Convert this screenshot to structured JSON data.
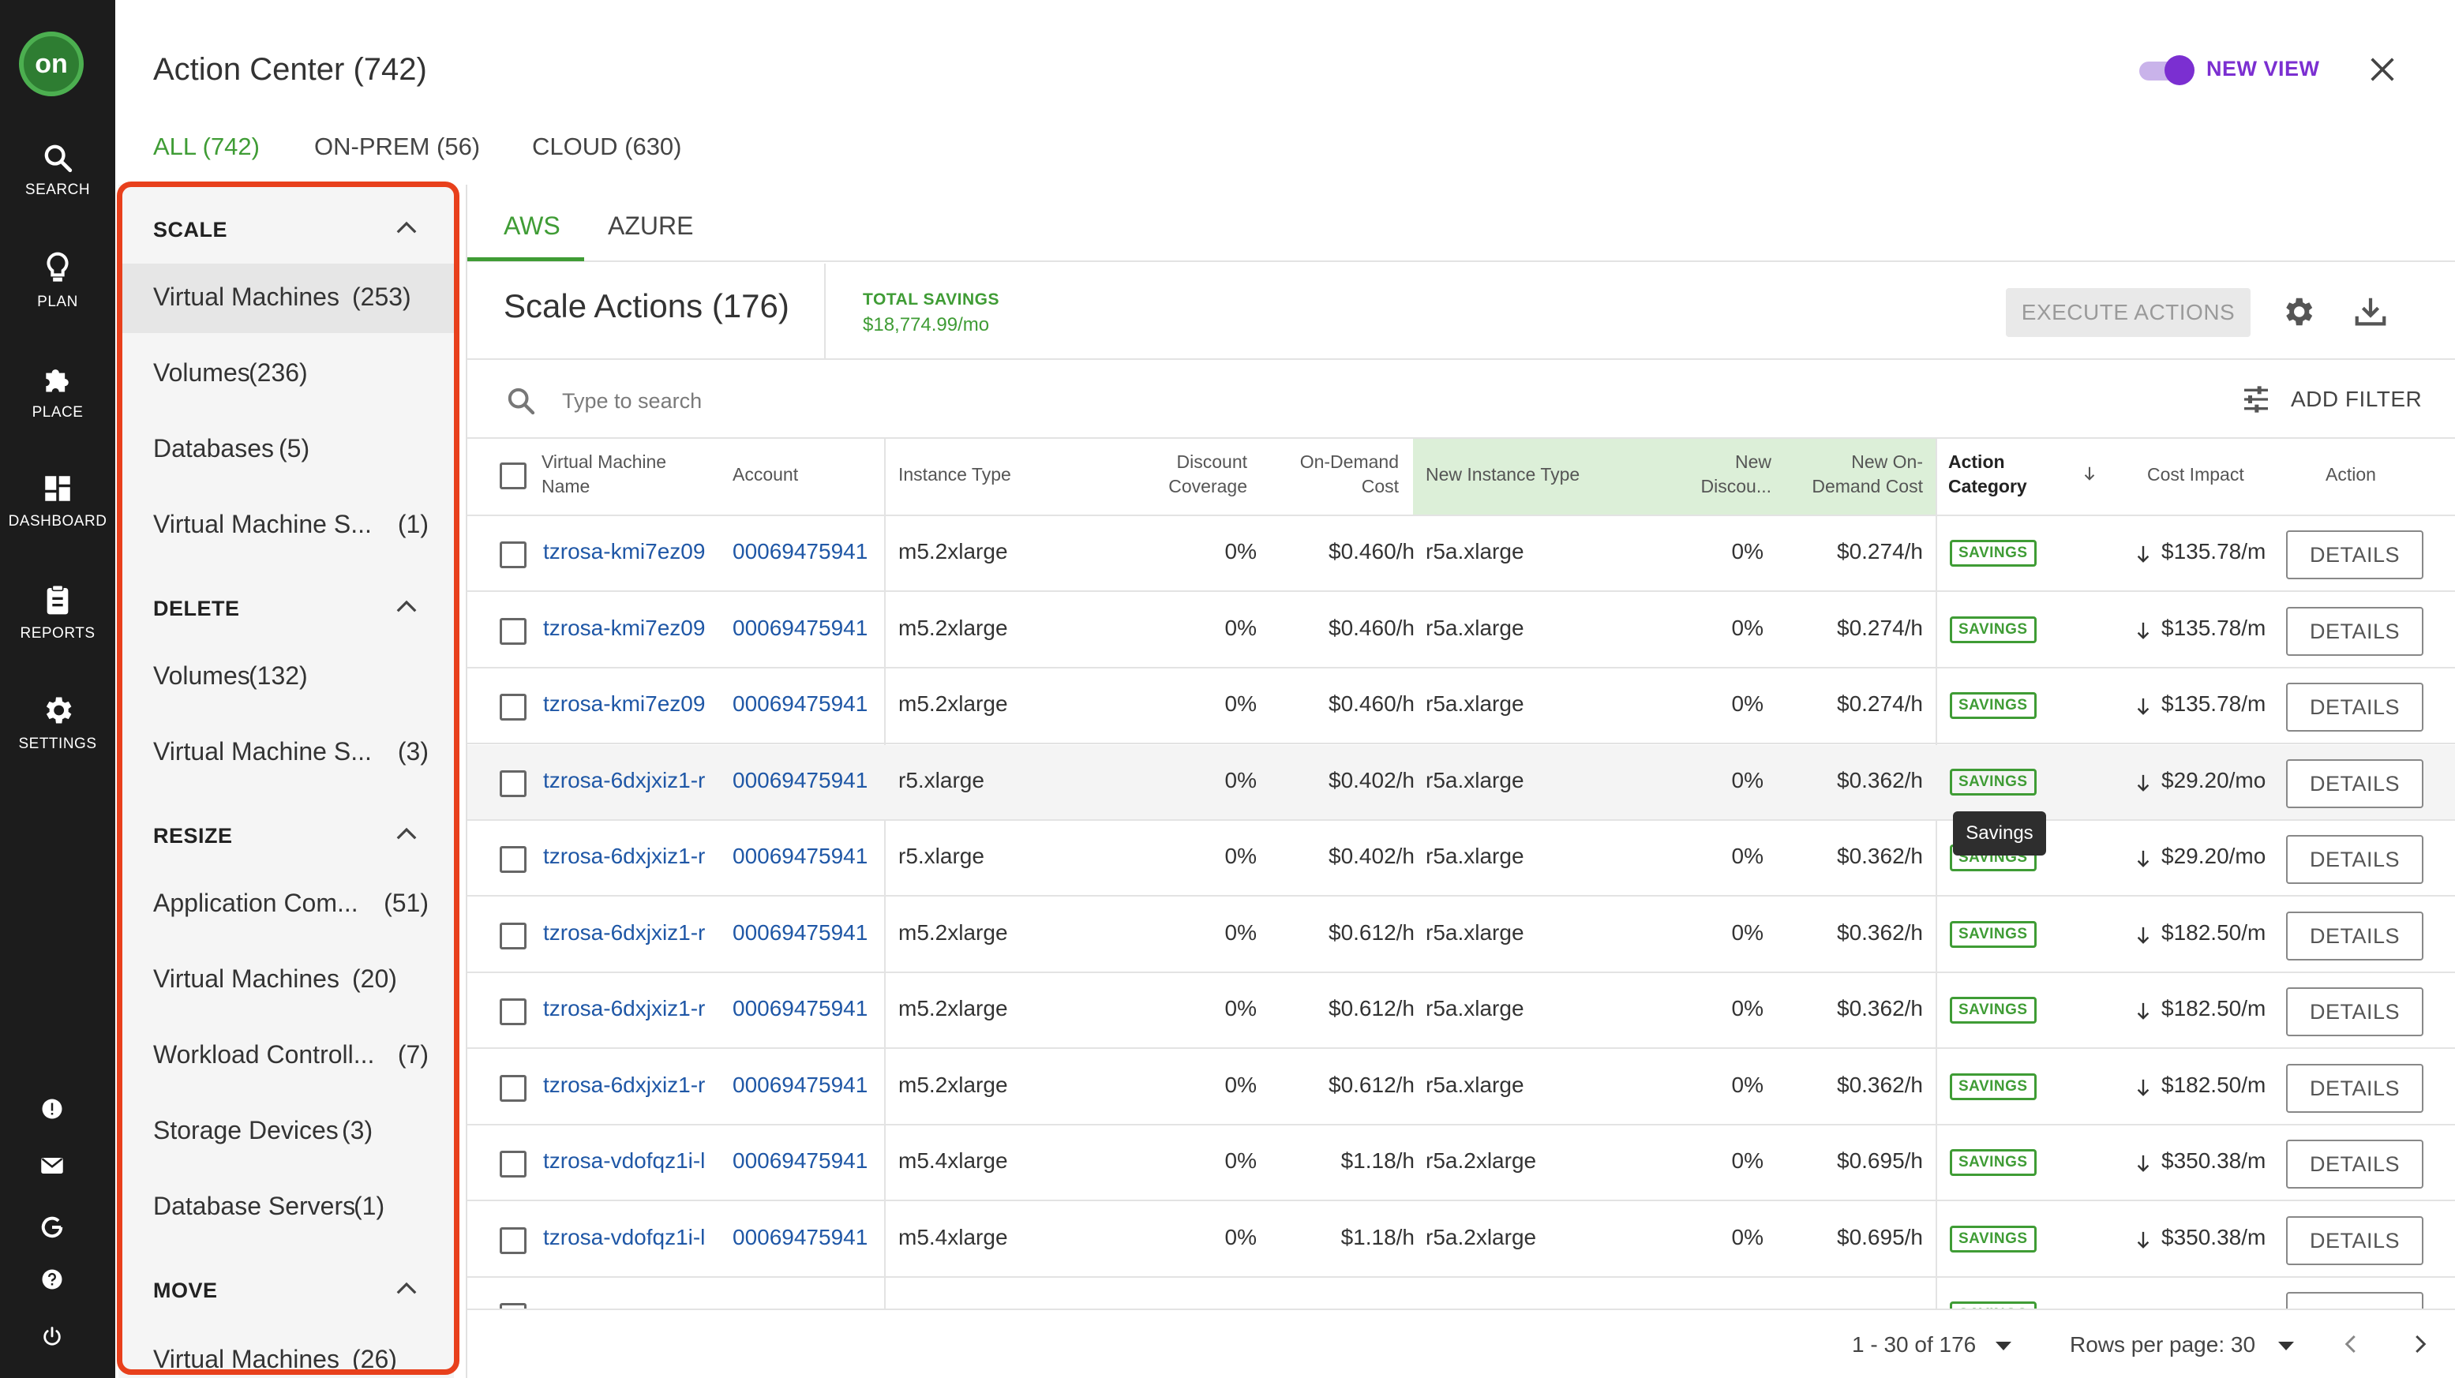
{
  "app": {
    "logo_text": "on",
    "title": "Action Center (742)",
    "new_view_label": "NEW VIEW",
    "new_view_enabled": true
  },
  "rail": {
    "nav": [
      {
        "label": "SEARCH",
        "icon": "search-icon"
      },
      {
        "label": "PLAN",
        "icon": "lightbulb-icon"
      },
      {
        "label": "PLACE",
        "icon": "puzzle-icon"
      },
      {
        "label": "DASHBOARD",
        "icon": "dashboard-icon"
      },
      {
        "label": "REPORTS",
        "icon": "clipboard-icon"
      },
      {
        "label": "SETTINGS",
        "icon": "gear-icon"
      }
    ],
    "bottom_icons": [
      "alert-icon",
      "mail-icon",
      "google-icon",
      "help-icon",
      "power-icon"
    ]
  },
  "top_tabs": [
    {
      "label": "ALL (742)",
      "active": true
    },
    {
      "label": "ON-PREM (56)",
      "active": false
    },
    {
      "label": "CLOUD (630)",
      "active": false
    }
  ],
  "sidebar": {
    "groups": [
      {
        "title": "SCALE",
        "items": [
          {
            "name": "Virtual Machines",
            "count": "(253)",
            "selected": true
          },
          {
            "name": "Volumes",
            "count": "(236)"
          },
          {
            "name": "Databases",
            "count": "(5)"
          },
          {
            "name": "Virtual Machine S...",
            "count": "(1)"
          }
        ]
      },
      {
        "title": "DELETE",
        "items": [
          {
            "name": "Volumes",
            "count": "(132)"
          },
          {
            "name": "Virtual Machine S...",
            "count": "(3)"
          }
        ]
      },
      {
        "title": "RESIZE",
        "items": [
          {
            "name": "Application Com...",
            "count": "(51)"
          },
          {
            "name": "Virtual Machines",
            "count": "(20)"
          },
          {
            "name": "Workload Controll...",
            "count": "(7)"
          },
          {
            "name": "Storage Devices",
            "count": "(3)"
          },
          {
            "name": "Database Servers",
            "count": "(1)"
          }
        ]
      },
      {
        "title": "MOVE",
        "items": [
          {
            "name": "Virtual Machines",
            "count": "(26)"
          }
        ]
      }
    ]
  },
  "cloud_tabs": [
    {
      "label": "AWS",
      "active": true
    },
    {
      "label": "AZURE",
      "active": false
    }
  ],
  "panel": {
    "title": "Scale Actions (176)",
    "total_savings_label": "TOTAL SAVINGS",
    "total_savings_value": "$18,774.99/mo",
    "execute_label": "EXECUTE ACTIONS",
    "search_placeholder": "Type to search",
    "add_filter_label": "ADD FILTER"
  },
  "table": {
    "columns": {
      "vm_name": "Virtual Machine Name",
      "account": "Account",
      "instance_type": "Instance Type",
      "discount_coverage": "Discount Coverage",
      "on_demand_cost": "On-Demand Cost",
      "new_instance_type": "New Instance Type",
      "new_discount": "New Discou...",
      "new_on_demand_cost": "New On-Demand Cost",
      "action_category": "Action Category",
      "cost_impact": "Cost Impact",
      "action": "Action"
    },
    "rows": [
      {
        "vm": "tzrosa-kmi7ez09",
        "account": "00069475941",
        "itype": "m5.2xlarge",
        "dcov": "0%",
        "odc": "$0.460/h",
        "nitype": "r5a.xlarge",
        "ndisc": "0%",
        "nodc": "$0.274/h",
        "cat": "SAVINGS",
        "impact": "$135.78/m",
        "action": "DETAILS"
      },
      {
        "vm": "tzrosa-kmi7ez09",
        "account": "00069475941",
        "itype": "m5.2xlarge",
        "dcov": "0%",
        "odc": "$0.460/h",
        "nitype": "r5a.xlarge",
        "ndisc": "0%",
        "nodc": "$0.274/h",
        "cat": "SAVINGS",
        "impact": "$135.78/m",
        "action": "DETAILS"
      },
      {
        "vm": "tzrosa-kmi7ez09",
        "account": "00069475941",
        "itype": "m5.2xlarge",
        "dcov": "0%",
        "odc": "$0.460/h",
        "nitype": "r5a.xlarge",
        "ndisc": "0%",
        "nodc": "$0.274/h",
        "cat": "SAVINGS",
        "impact": "$135.78/m",
        "action": "DETAILS"
      },
      {
        "vm": "tzrosa-6dxjxiz1-r",
        "account": "00069475941",
        "itype": "r5.xlarge",
        "dcov": "0%",
        "odc": "$0.402/h",
        "nitype": "r5a.xlarge",
        "ndisc": "0%",
        "nodc": "$0.362/h",
        "cat": "SAVINGS",
        "impact": "$29.20/mo",
        "action": "DETAILS"
      },
      {
        "vm": "tzrosa-6dxjxiz1-r",
        "account": "00069475941",
        "itype": "r5.xlarge",
        "dcov": "0%",
        "odc": "$0.402/h",
        "nitype": "r5a.xlarge",
        "ndisc": "0%",
        "nodc": "$0.362/h",
        "cat": "SAVINGS",
        "impact": "$29.20/mo",
        "action": "DETAILS"
      },
      {
        "vm": "tzrosa-6dxjxiz1-r",
        "account": "00069475941",
        "itype": "m5.2xlarge",
        "dcov": "0%",
        "odc": "$0.612/h",
        "nitype": "r5a.xlarge",
        "ndisc": "0%",
        "nodc": "$0.362/h",
        "cat": "SAVINGS",
        "impact": "$182.50/m",
        "action": "DETAILS"
      },
      {
        "vm": "tzrosa-6dxjxiz1-r",
        "account": "00069475941",
        "itype": "m5.2xlarge",
        "dcov": "0%",
        "odc": "$0.612/h",
        "nitype": "r5a.xlarge",
        "ndisc": "0%",
        "nodc": "$0.362/h",
        "cat": "SAVINGS",
        "impact": "$182.50/m",
        "action": "DETAILS"
      },
      {
        "vm": "tzrosa-6dxjxiz1-r",
        "account": "00069475941",
        "itype": "m5.2xlarge",
        "dcov": "0%",
        "odc": "$0.612/h",
        "nitype": "r5a.xlarge",
        "ndisc": "0%",
        "nodc": "$0.362/h",
        "cat": "SAVINGS",
        "impact": "$182.50/m",
        "action": "DETAILS"
      },
      {
        "vm": "tzrosa-vdofqz1i-l",
        "account": "00069475941",
        "itype": "m5.4xlarge",
        "dcov": "0%",
        "odc": "$1.18/h",
        "nitype": "r5a.2xlarge",
        "ndisc": "0%",
        "nodc": "$0.695/h",
        "cat": "SAVINGS",
        "impact": "$350.38/m",
        "action": "DETAILS"
      },
      {
        "vm": "tzrosa-vdofqz1i-l",
        "account": "00069475941",
        "itype": "m5.4xlarge",
        "dcov": "0%",
        "odc": "$1.18/h",
        "nitype": "r5a.2xlarge",
        "ndisc": "0%",
        "nodc": "$0.695/h",
        "cat": "SAVINGS",
        "impact": "$350.38/m",
        "action": "DETAILS"
      }
    ],
    "hovered_row": 3,
    "tooltip": "Savings"
  },
  "pagination": {
    "range": "1 - 30 of 176",
    "rows_per_page_label": "Rows per page: 30"
  },
  "colors": {
    "accent_green": "#3f9c35",
    "toggle_purple": "#7b2fd1",
    "highlight_outline": "#e8401c",
    "rail_bg": "#1c1c1c",
    "link_blue": "#1f57a6"
  }
}
